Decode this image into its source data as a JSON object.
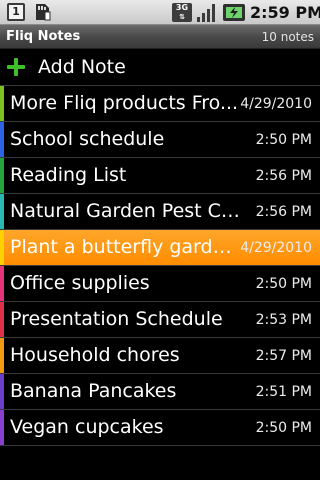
{
  "status_bar": {
    "notification_icons": [
      "sim-card-icon",
      "sd-card-icon"
    ],
    "notification_digit": "1",
    "network_label": "3G",
    "icons": [
      "signal-strength-icon",
      "battery-charging-icon"
    ],
    "time": "2:59 PM"
  },
  "title_bar": {
    "app_name": "Fliq Notes",
    "count_label": "10 notes"
  },
  "add_note": {
    "icon": "plus-icon",
    "label": "Add Note",
    "icon_color": "#3fbf2a"
  },
  "notes": [
    {
      "title": "More Fliq products Fro...",
      "date": "4/29/2010",
      "color": "#7dc21e",
      "selected": false
    },
    {
      "title": "School schedule",
      "date": "2:50 PM",
      "color": "#2f63e6",
      "selected": false
    },
    {
      "title": "Reading List",
      "date": "2:56 PM",
      "color": "#22a63a",
      "selected": false
    },
    {
      "title": "Natural Garden Pest Co...",
      "date": "2:56 PM",
      "color": "#28b7b3",
      "selected": false
    },
    {
      "title": "Plant a butterfly garde...",
      "date": "4/29/2010",
      "color": "#ffd000",
      "selected": true
    },
    {
      "title": "Office supplies",
      "date": "2:50 PM",
      "color": "#e8327a",
      "selected": false
    },
    {
      "title": "Presentation Schedule",
      "date": "2:53 PM",
      "color": "#e0304c",
      "selected": false
    },
    {
      "title": "Household chores",
      "date": "2:57 PM",
      "color": "#f39a12",
      "selected": false
    },
    {
      "title": "Banana Pancakes",
      "date": "2:51 PM",
      "color": "#6a3ec8",
      "selected": false
    },
    {
      "title": "Vegan cupcakes",
      "date": "2:50 PM",
      "color": "#8a3fd0",
      "selected": false
    }
  ],
  "colors": {
    "selected_row": "#ff9a10",
    "background": "#000000"
  }
}
